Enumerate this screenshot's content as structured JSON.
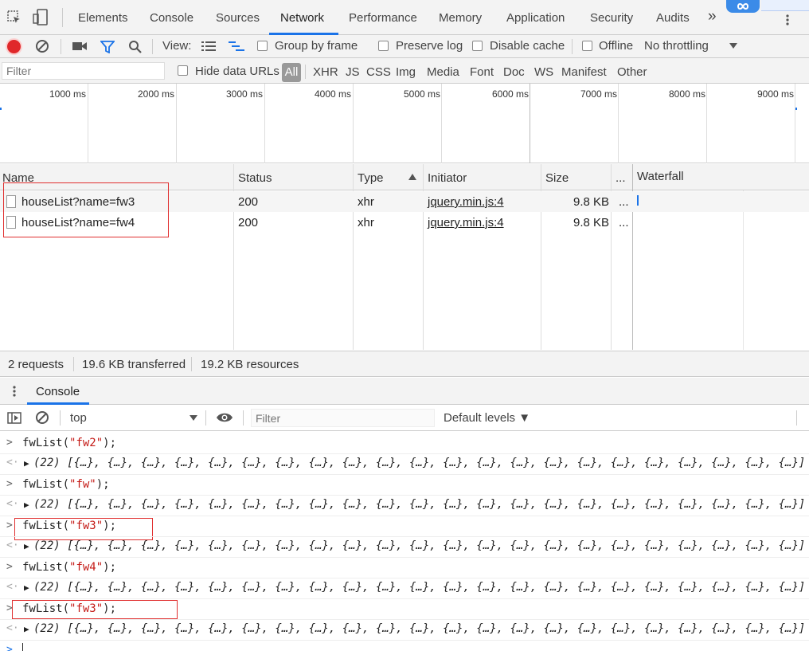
{
  "tabs": [
    "Elements",
    "Console",
    "Sources",
    "Network",
    "Performance",
    "Memory",
    "Application",
    "Security",
    "Audits"
  ],
  "active_tab": "Network",
  "tabs_overflow": "»",
  "toolbar": {
    "view_label": "View:",
    "group_by_frame": "Group by frame",
    "preserve_log": "Preserve log",
    "disable_cache": "Disable cache",
    "offline": "Offline",
    "throttling": "No throttling"
  },
  "filterbar": {
    "placeholder": "Filter",
    "hide_data_urls": "Hide data URLs",
    "all": "All",
    "types": [
      "XHR",
      "JS",
      "CSS",
      "Img",
      "Media",
      "Font",
      "Doc",
      "WS",
      "Manifest",
      "Other"
    ]
  },
  "timeline_ticks": [
    "1000 ms",
    "2000 ms",
    "3000 ms",
    "4000 ms",
    "5000 ms",
    "6000 ms",
    "7000 ms",
    "8000 ms",
    "9000 ms"
  ],
  "columns": {
    "name": "Name",
    "status": "Status",
    "type": "Type",
    "initiator": "Initiator",
    "size": "Size",
    "more": "...",
    "waterfall": "Waterfall"
  },
  "requests": [
    {
      "name": "houseList?name=fw3",
      "status": "200",
      "type": "xhr",
      "initiator": "jquery.min.js:4",
      "size": "9.8 KB",
      "more": "..."
    },
    {
      "name": "houseList?name=fw4",
      "status": "200",
      "type": "xhr",
      "initiator": "jquery.min.js:4",
      "size": "9.8 KB",
      "more": "..."
    }
  ],
  "summary": {
    "requests": "2 requests",
    "transferred": "19.6 KB transferred",
    "resources": "19.2 KB resources"
  },
  "drawer": {
    "tab": "Console"
  },
  "console_toolbar": {
    "context": "top",
    "filter_placeholder": "Filter",
    "levels": "Default levels ▼"
  },
  "console_lines": [
    {
      "kind": "input",
      "pre": "fwList(",
      "arg": "\"fw2\"",
      "post": ");"
    },
    {
      "kind": "output",
      "text": "(22) [{…}, {…}, {…}, {…}, {…}, {…}, {…}, {…}, {…}, {…}, {…}, {…}, {…}, {…}, {…}, {…}, {…}, {…}, {…}, {…}, {…}, {…}]"
    },
    {
      "kind": "input",
      "pre": "fwList(",
      "arg": "\"fw\"",
      "post": ");"
    },
    {
      "kind": "output",
      "text": "(22) [{…}, {…}, {…}, {…}, {…}, {…}, {…}, {…}, {…}, {…}, {…}, {…}, {…}, {…}, {…}, {…}, {…}, {…}, {…}, {…}, {…}, {…}]"
    },
    {
      "kind": "input",
      "pre": "fwList(",
      "arg": "\"fw3\"",
      "post": ");"
    },
    {
      "kind": "output",
      "text": "(22) [{…}, {…}, {…}, {…}, {…}, {…}, {…}, {…}, {…}, {…}, {…}, {…}, {…}, {…}, {…}, {…}, {…}, {…}, {…}, {…}, {…}, {…}]"
    },
    {
      "kind": "input",
      "pre": "fwList(",
      "arg": "\"fw4\"",
      "post": ");"
    },
    {
      "kind": "output",
      "text": "(22) [{…}, {…}, {…}, {…}, {…}, {…}, {…}, {…}, {…}, {…}, {…}, {…}, {…}, {…}, {…}, {…}, {…}, {…}, {…}, {…}, {…}, {…}]"
    },
    {
      "kind": "input",
      "pre": "fwList(",
      "arg": "\"fw3\"",
      "post": ");"
    },
    {
      "kind": "output",
      "text": "(22) [{…}, {…}, {…}, {…}, {…}, {…}, {…}, {…}, {…}, {…}, {…}, {…}, {…}, {…}, {…}, {…}, {…}, {…}, {…}, {…}, {…}, {…}]"
    }
  ],
  "colors": {
    "accent": "#1a73e8",
    "record": "#e0282a",
    "highlight_box": "#e03030",
    "string": "#c41a16"
  },
  "icons": [
    "inspect-icon",
    "device-toggle-icon",
    "record-icon",
    "clear-icon",
    "camera-icon",
    "filter-icon",
    "search-icon",
    "list-view-icon",
    "waterfall-view-icon",
    "kebab-menu-icon",
    "sidebar-toggle-icon",
    "eye-icon"
  ]
}
